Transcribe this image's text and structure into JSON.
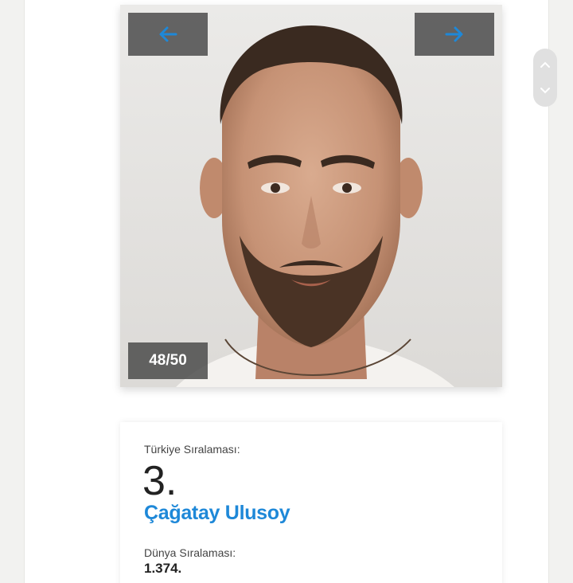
{
  "gallery": {
    "counter": "48/50",
    "prev_icon": "arrow-left-icon",
    "next_icon": "arrow-right-icon",
    "accent_color": "#1e88d8"
  },
  "scroll": {
    "up_icon": "chevron-up-icon",
    "down_icon": "chevron-down-icon"
  },
  "profile": {
    "turkey_rank_label": "Türkiye Sıralaması:",
    "turkey_rank": "3.",
    "name": "Çağatay Ulusoy",
    "world_rank_label": "Dünya Sıralaması:",
    "world_rank": "1.374."
  }
}
